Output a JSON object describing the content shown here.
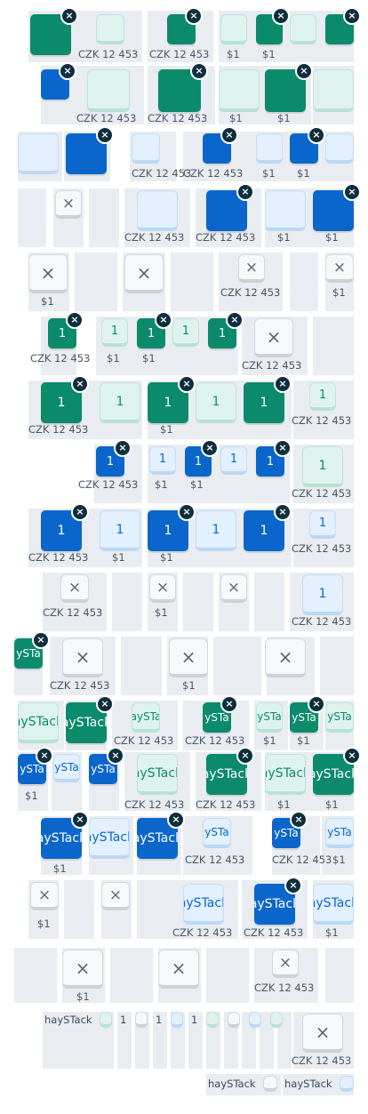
{
  "labels": {
    "price": "CZK 12 453",
    "dollar": "$1",
    "one": "1",
    "brand": "haySTack",
    "brand_clipped": "aySTack",
    "brand_clipped_short": "aySTa",
    "brand_clipped_mid": "aySTac",
    "brand_cut": "ySTa",
    "remove": "×"
  },
  "colors": {
    "solid_green": "#0b8a6c",
    "solid_blue": "#0b66cc",
    "light_green": "#dff3ee",
    "light_blue": "#e2f0ff",
    "light_grey": "#f7f8fa",
    "cell_background": "#e9ecf0",
    "badge": "#0e2f3d"
  },
  "icons": {
    "remove_badge": "close-icon",
    "empty_tile": "close-icon"
  }
}
